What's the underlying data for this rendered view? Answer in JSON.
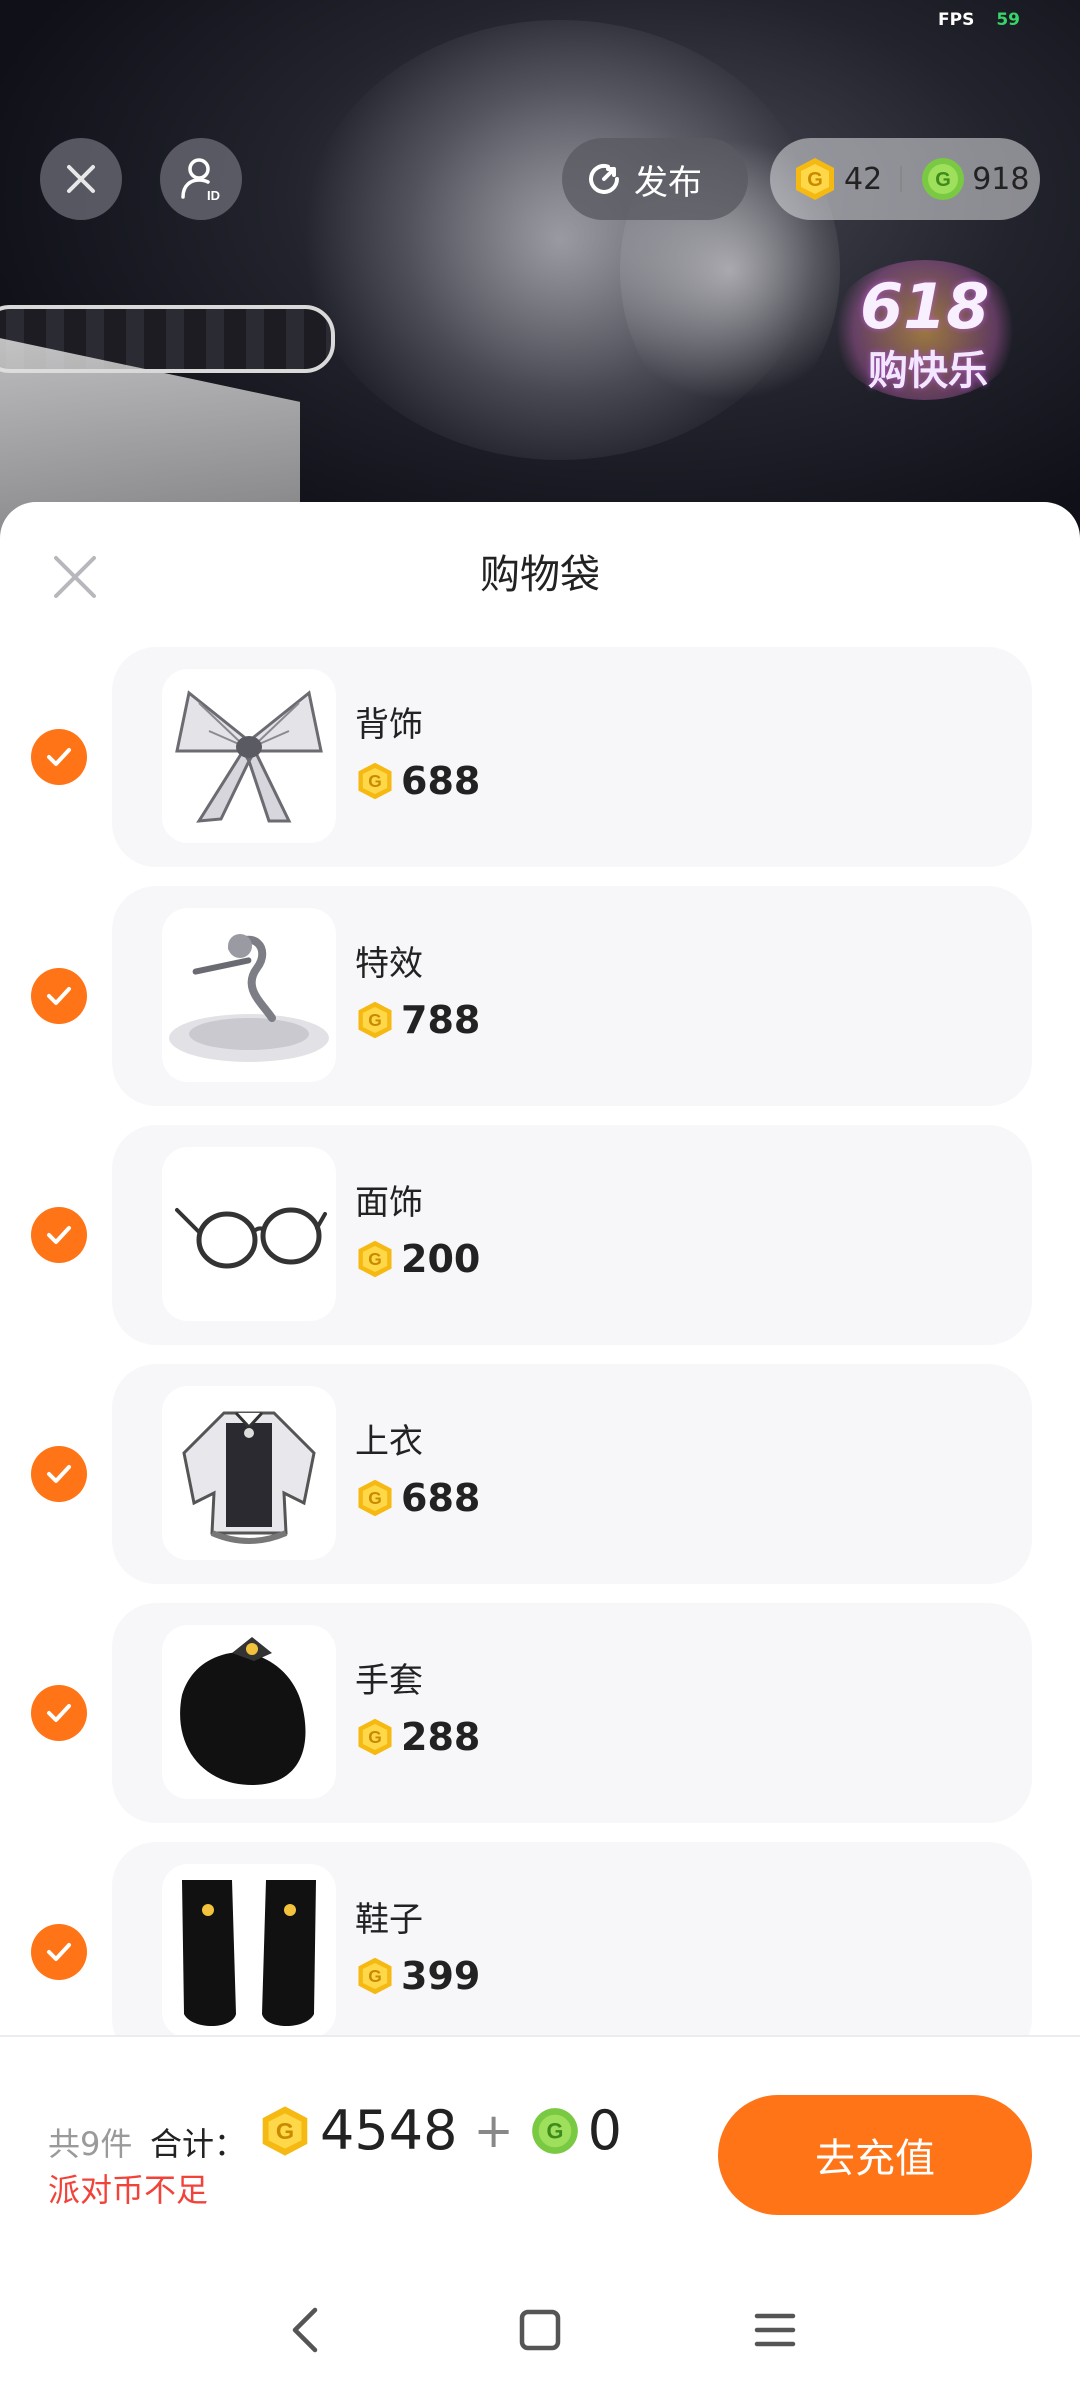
{
  "status": {
    "fps_label": "FPS",
    "fps_value": "59"
  },
  "header": {
    "publish_label": "发布",
    "gold_balance": "42",
    "green_balance": "918"
  },
  "promo": {
    "line1": "618",
    "line2": "购快乐"
  },
  "sheet": {
    "title": "购物袋"
  },
  "items": [
    {
      "name": "背饰",
      "price": "688",
      "checked": true
    },
    {
      "name": "特效",
      "price": "788",
      "checked": true
    },
    {
      "name": "面饰",
      "price": "200",
      "checked": true
    },
    {
      "name": "上衣",
      "price": "688",
      "checked": true
    },
    {
      "name": "手套",
      "price": "288",
      "checked": true
    },
    {
      "name": "鞋子",
      "price": "399",
      "checked": true
    }
  ],
  "footer": {
    "count_label": "共9件",
    "total_label": "合计：",
    "gold_total": "4548",
    "plus": "+",
    "green_total": "0",
    "warning": "派对币不足",
    "recharge_label": "去充值"
  },
  "colors": {
    "accent": "#ff7417",
    "warning": "#f2433a",
    "gold_coin": "#f5b912",
    "green_coin": "#7ac943"
  }
}
